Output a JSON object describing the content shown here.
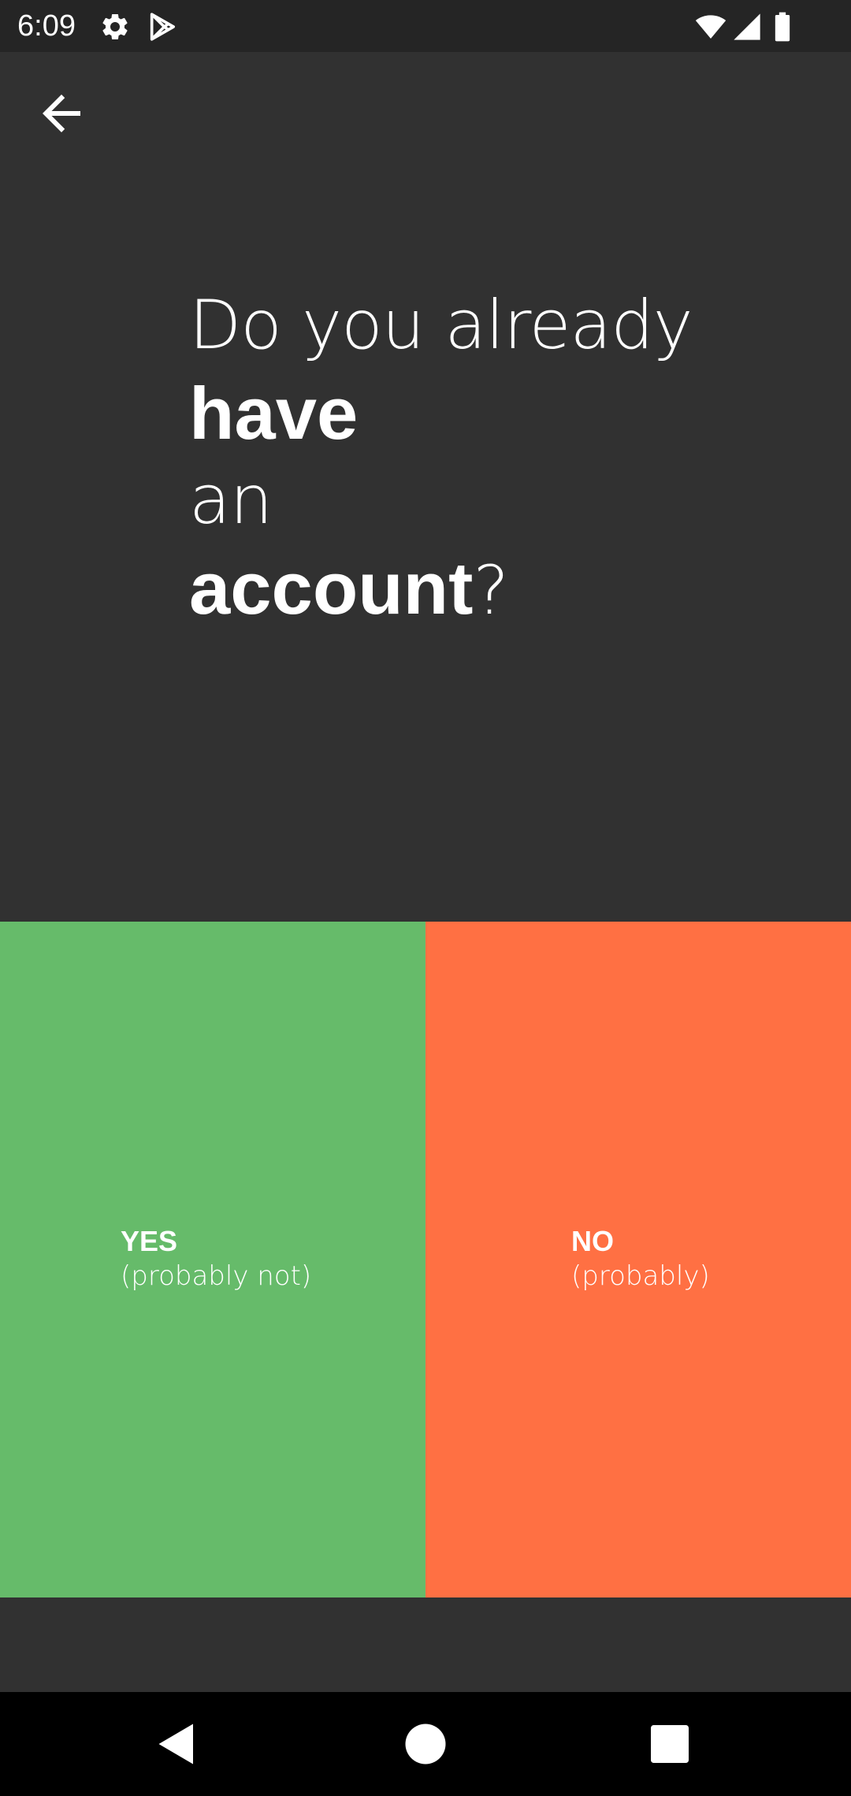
{
  "status_bar": {
    "time": "6:09",
    "icons_left": [
      "settings-gear-icon",
      "play-store-icon"
    ],
    "icons_right": [
      "wifi-icon",
      "cell-signal-icon",
      "battery-icon"
    ]
  },
  "app_bar": {
    "back_icon": "arrow-back-icon"
  },
  "question": {
    "line1": "Do you already",
    "line2": "have",
    "line3": "an",
    "line4_bold": "account",
    "line4_suffix": "?"
  },
  "answers": {
    "yes": {
      "title": "YES",
      "subtitle": "(probably not)",
      "color": "#66bb6a"
    },
    "no": {
      "title": "NO",
      "subtitle": "(probably)",
      "color": "#ff7043"
    }
  },
  "nav_bar": {
    "buttons": [
      "back-triangle-icon",
      "home-circle-icon",
      "recents-square-icon"
    ]
  },
  "colors": {
    "background": "#313131",
    "status_bar": "#252525",
    "nav_bar": "#000000"
  }
}
